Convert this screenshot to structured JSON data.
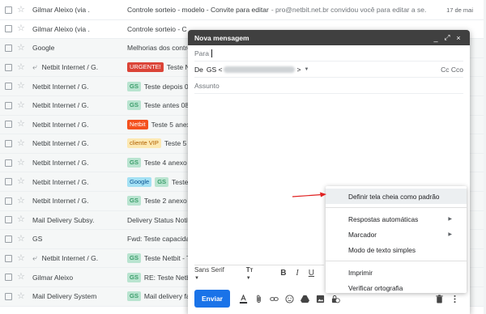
{
  "inbox": {
    "rows": [
      {
        "sender": "Gilmar Aleixo (via .",
        "reply": false,
        "labels": [],
        "subject": "Controle sorteio - modelo - Convite para editar",
        "snippet": "- pro@netbit.net.br convidou você para editar a se...",
        "date": "17 de mai",
        "unread": true
      },
      {
        "sender": "Gilmar Aleixo (via .",
        "reply": false,
        "labels": [],
        "subject": "Controle sorteio - C",
        "snippet": "",
        "date": "",
        "unread": true
      },
      {
        "sender": "Google",
        "reply": false,
        "labels": [],
        "subject": "Melhorias dos contro",
        "snippet": "",
        "date": "",
        "unread": false
      },
      {
        "sender": "Netbit Internet / G.",
        "reply": true,
        "labels": [
          {
            "text": "URGENTE!",
            "bg": "#db4437",
            "fg": "#ffffff"
          }
        ],
        "subject": "Teste Ne",
        "snippet": "",
        "date": "",
        "unread": false
      },
      {
        "sender": "Netbit Internet / G.",
        "reply": false,
        "labels": [
          {
            "text": "GS",
            "bg": "#b9e4d0",
            "fg": "#0b8043"
          }
        ],
        "subject": "Teste depois 08",
        "snippet": "",
        "date": "",
        "unread": false
      },
      {
        "sender": "Netbit Internet / G.",
        "reply": false,
        "labels": [
          {
            "text": "GS",
            "bg": "#b9e4d0",
            "fg": "#0b8043"
          }
        ],
        "subject": "Teste antes 08h",
        "snippet": "",
        "date": "",
        "unread": false
      },
      {
        "sender": "Netbit Internet / G.",
        "reply": false,
        "labels": [
          {
            "text": "Netbit",
            "bg": "#f4511e",
            "fg": "#ffffff"
          }
        ],
        "subject": "Teste 5 anex",
        "snippet": "",
        "date": "",
        "unread": false
      },
      {
        "sender": "Netbit Internet / G.",
        "reply": false,
        "labels": [
          {
            "text": "cliente VIP",
            "bg": "#fce8b2",
            "fg": "#b06000"
          }
        ],
        "subject": "Teste 5 a",
        "snippet": "",
        "date": "",
        "unread": false
      },
      {
        "sender": "Netbit Internet / G.",
        "reply": false,
        "labels": [
          {
            "text": "GS",
            "bg": "#b9e4d0",
            "fg": "#0b8043"
          }
        ],
        "subject": "Teste 4 anexo 1",
        "snippet": "",
        "date": "",
        "unread": false
      },
      {
        "sender": "Netbit Internet / G.",
        "reply": false,
        "labels": [
          {
            "text": "Google",
            "bg": "#a4e1f4",
            "fg": "#0b5394"
          },
          {
            "text": "GS",
            "bg": "#b9e4d0",
            "fg": "#0b8043"
          }
        ],
        "subject": "Teste 3",
        "snippet": "",
        "date": "",
        "unread": false
      },
      {
        "sender": "Netbit Internet / G.",
        "reply": false,
        "labels": [
          {
            "text": "GS",
            "bg": "#b9e4d0",
            "fg": "#0b8043"
          }
        ],
        "subject": "Teste 2 anexo 1",
        "snippet": "",
        "date": "",
        "unread": false
      },
      {
        "sender": "Mail Delivery Subsy.",
        "reply": false,
        "labels": [],
        "subject": "Delivery Status Notif",
        "snippet": "",
        "date": "",
        "unread": false
      },
      {
        "sender": "GS",
        "reply": false,
        "labels": [],
        "subject": "Fwd: Teste capacida",
        "snippet": "",
        "date": "",
        "unread": false
      },
      {
        "sender": "Netbit Internet / G.",
        "reply": true,
        "labels": [
          {
            "text": "GS",
            "bg": "#b9e4d0",
            "fg": "#0b8043"
          }
        ],
        "subject": "Teste Netbit - Te",
        "snippet": "",
        "date": "",
        "unread": false
      },
      {
        "sender": "Gilmar Aleixo",
        "reply": false,
        "labels": [
          {
            "text": "GS",
            "bg": "#b9e4d0",
            "fg": "#0b8043"
          }
        ],
        "subject": "RE: Teste Netbi",
        "snippet": "",
        "date": "",
        "unread": false
      },
      {
        "sender": "Mail Delivery System",
        "reply": false,
        "labels": [
          {
            "text": "GS",
            "bg": "#b9e4d0",
            "fg": "#0b8043"
          }
        ],
        "subject": "Mail delivery fa",
        "snippet": "",
        "date": "",
        "unread": false
      }
    ]
  },
  "compose": {
    "title": "Nova mensagem",
    "minimize": "_",
    "fullscreen": "⤢",
    "close": "×",
    "to_label": "Para",
    "from_label": "De",
    "from_name": "GS <",
    "from_suffix": ">",
    "cc_label": "Cc Cco",
    "subject_placeholder": "Assunto",
    "font_name": "Sans Serif",
    "send_label": "Enviar"
  },
  "menu": {
    "items": [
      {
        "label": "Definir tela cheia como padrão",
        "submenu": false,
        "highlighted": true,
        "separator_after": true
      },
      {
        "label": "Respostas automáticas",
        "submenu": true,
        "highlighted": false,
        "separator_after": false
      },
      {
        "label": "Marcador",
        "submenu": true,
        "highlighted": false,
        "separator_after": false
      },
      {
        "label": "Modo de texto simples",
        "submenu": false,
        "highlighted": false,
        "separator_after": true
      },
      {
        "label": "Imprimir",
        "submenu": false,
        "highlighted": false,
        "separator_after": false
      },
      {
        "label": "Verificar ortografia",
        "submenu": false,
        "highlighted": false,
        "separator_after": false
      }
    ]
  },
  "colors": {
    "compose_header": "#404040",
    "send_button": "#1a73e8",
    "arrow": "#e02020"
  },
  "icons": {
    "star": "star-icon",
    "reply": "reply-icon",
    "dropdown": "chevron-down-icon",
    "text_size": "text-size-icon",
    "bold": "bold-icon",
    "italic": "italic-icon",
    "underline": "underline-icon",
    "text_color": "text-color-icon",
    "attach": "paperclip-icon",
    "link": "link-icon",
    "emoji": "emoji-icon",
    "drive": "drive-icon",
    "photo": "photo-icon",
    "confidential": "lock-clock-icon",
    "trash": "trash-icon",
    "more": "more-vert-icon"
  }
}
